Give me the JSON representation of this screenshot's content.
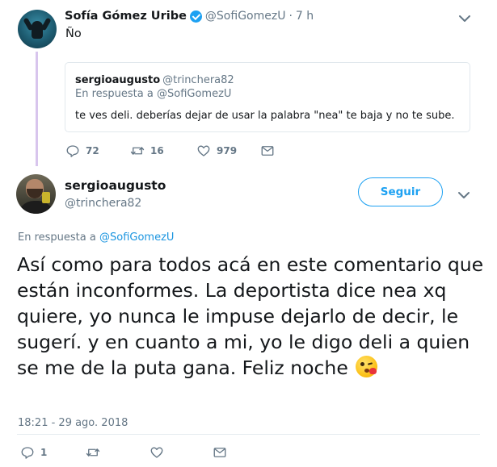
{
  "original_tweet": {
    "name": "Sofía Gómez Uribe",
    "handle": "@SofiGomezU",
    "separator": "·",
    "time": "7 h",
    "text": "Ño",
    "quoted": {
      "name": "sergioaugusto",
      "handle": "@trinchera82",
      "reply_prefix": "En respuesta a",
      "reply_to": "@SofiGomezU",
      "text": "te ves deli. deberías dejar de usar la palabra \"nea\" te baja y no te sube."
    },
    "actions": {
      "replies": "72",
      "retweets": "16",
      "likes": "979"
    }
  },
  "main_tweet": {
    "name": "sergioaugusto",
    "handle": "@trinchera82",
    "follow_label": "Seguir",
    "reply_prefix": "En respuesta a",
    "reply_to": "@SofiGomezU",
    "text": "Así como para todos acá en este comentario que están inconformes. La deportista dice nea xq quiere, yo nunca le impuse dejarlo de decir, le sugerí.  y en cuanto a mi,  yo le digo deli a quien se me de la  puta gana. Feliz noche",
    "timestamp": "18:21 - 29 ago. 2018",
    "actions": {
      "replies": "1"
    }
  },
  "colors": {
    "accent": "#1da1f2",
    "mention": "#1b95e0",
    "muted": "#657786",
    "thread_line": "#d8c5ed",
    "icon": "#657786"
  },
  "icons": [
    "verified-icon",
    "chevron-down-icon",
    "reply-icon",
    "retweet-icon",
    "like-icon",
    "message-icon",
    "kiss-emoji"
  ]
}
